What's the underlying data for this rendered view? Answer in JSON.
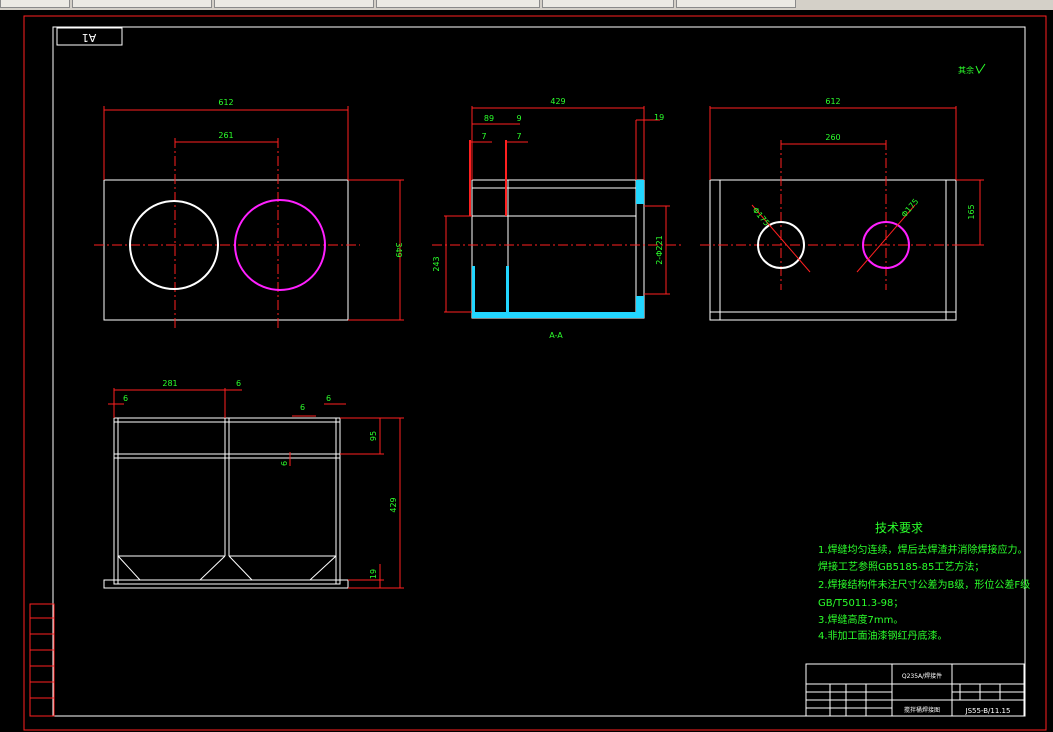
{
  "tabs": [
    "",
    "",
    "",
    "",
    "",
    ""
  ],
  "sheet": {
    "size_label": "A1",
    "roughness_note": "其余"
  },
  "views": {
    "front": {
      "dims": {
        "width": "612",
        "spacing": "261",
        "height": "349"
      }
    },
    "section": {
      "dims": {
        "total": "429",
        "d89": "89",
        "d9": "9",
        "d19": "19",
        "d7a": "7",
        "d7b": "7",
        "h243": "243",
        "dia": "2-Φ221"
      },
      "label": "A-A"
    },
    "side": {
      "dims": {
        "width": "612",
        "spacing": "260",
        "height": "165",
        "dia1": "Φ175",
        "dia2": "Φ175"
      }
    },
    "bottom": {
      "dims": {
        "w281": "281",
        "t6a": "6",
        "t6b": "6",
        "t6c": "6",
        "t6d": "6",
        "t6e": "6",
        "h95": "95",
        "h429": "429",
        "h19": "19"
      }
    }
  },
  "tech": {
    "title": "技术要求",
    "lines": [
      "1.焊缝均匀连续，焊后去焊渣并消除焊接应力。",
      "   焊接工艺参照GB5185-85工艺方法；",
      "2.焊接结构件未注尺寸公差为B级，形位公差F级",
      "   GB/T5011.3-98；",
      "3.焊缝高度7mm。",
      "4.非加工面油漆钢红丹底漆。"
    ]
  },
  "title_block": {
    "material": "Q235A/焊接件",
    "drawing_no": "JS55-B/11.15",
    "name": "搅拌桶焊接图"
  },
  "stamp": {
    "labels": [
      "",
      "",
      "",
      "",
      "",
      ""
    ]
  }
}
